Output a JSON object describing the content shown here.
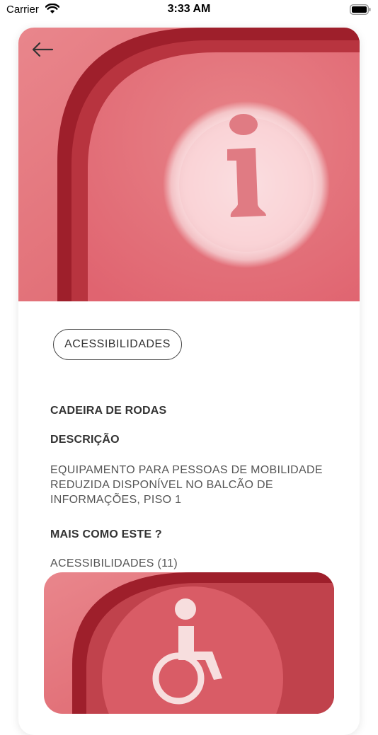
{
  "status_bar": {
    "carrier": "Carrier",
    "time": "3:33 AM"
  },
  "hero": {
    "image_icon": "info-icon",
    "background_color": "#e06b74"
  },
  "detail": {
    "category_chip": "ACESSIBILIDADES",
    "title": "CADEIRA DE RODAS",
    "description_heading": "DESCRIÇÃO",
    "description": "EQUIPAMENTO PARA PESSOAS DE MOBILIDADE REDUZIDA DISPONÍVEL NO BALCÃO DE INFORMAÇÕES, PISO 1",
    "more_heading": "MAIS COMO ESTE ?",
    "more_link": "ACESSIBILIDADES (11)"
  },
  "related": {
    "image_icon": "wheelchair-icon"
  }
}
